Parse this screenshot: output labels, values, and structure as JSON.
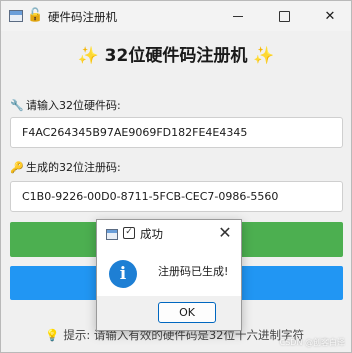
{
  "window": {
    "title": "硬件码注册机",
    "app_icon": "window-app-icon",
    "lock_icon": "🔓"
  },
  "heading": "✨ 32位硬件码注册机 ✨",
  "hardware_code": {
    "icon": "🔧",
    "label": "请输入32位硬件码:",
    "value": "F4AC264345B97AE9069FD182FE4E4345"
  },
  "registration_code": {
    "icon": "🔑",
    "label": "生成的32位注册码:",
    "value": "C1B0-9226-00D0-8711-5FCB-CEC7-0986-5560"
  },
  "buttons": {
    "generate_color": "#4caf50",
    "copy_color": "#2196f3"
  },
  "hint": {
    "icon": "💡",
    "text": "提示: 请输入有效的硬件码是32位十六进制字符"
  },
  "watermark": "CSDN @创客白泽",
  "dialog": {
    "title": "成功",
    "check_glyph": "✓",
    "info_glyph": "i",
    "message": "注册码已生成!",
    "ok_label": "OK",
    "close_glyph": "✕"
  }
}
